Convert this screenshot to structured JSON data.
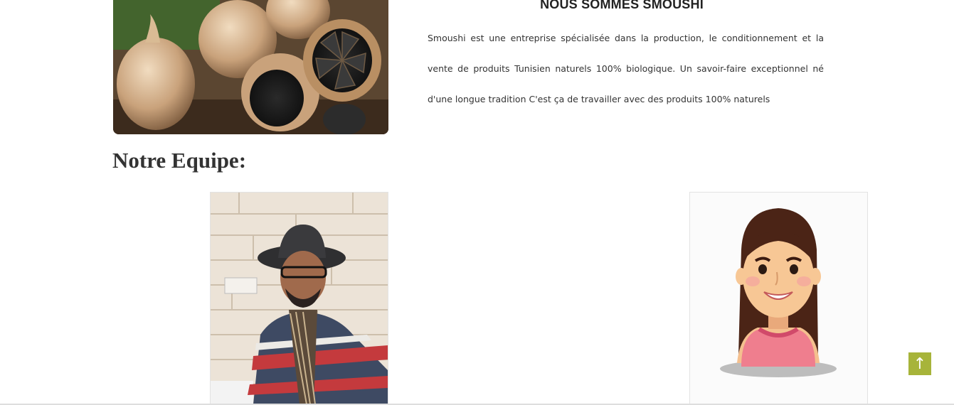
{
  "about": {
    "title": "NOUS SOMMES SMOUSHI",
    "paragraph": "Smoushi est une entreprise spécialisée dans la production, le conditionnement et la vente de produits Tunisien naturels 100% biologique. Un savoir-faire exceptionnel né d'une longue tradition C'est ça de travailler avec des produits 100% naturels"
  },
  "team": {
    "heading": "Notre Equipe:"
  },
  "scroll_top": {
    "icon": "arrow-up-icon",
    "glyph": "↑"
  },
  "colors": {
    "accent": "#a7b43a",
    "text": "#333333",
    "border": "#e3e3e3"
  }
}
